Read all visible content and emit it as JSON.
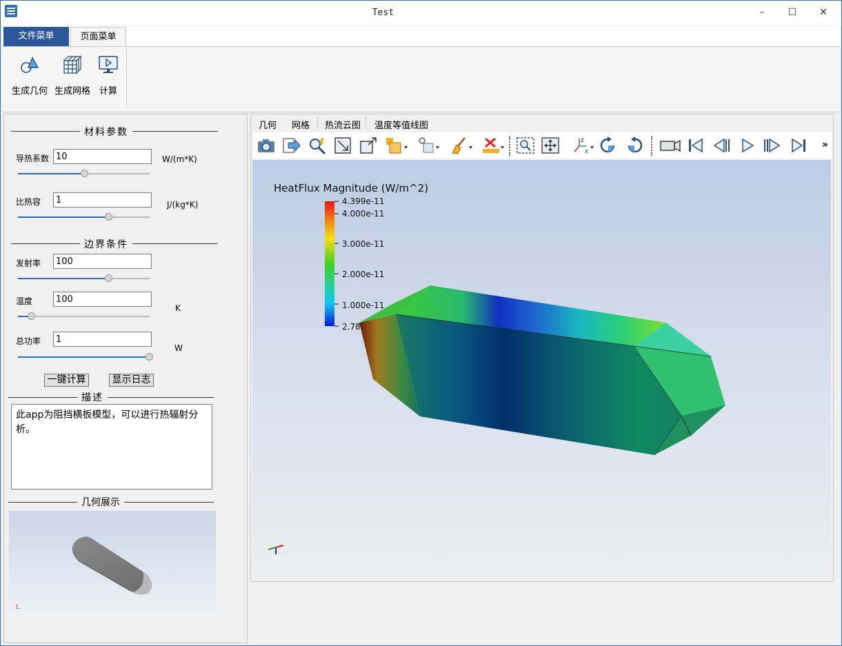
{
  "window": {
    "title": "Test",
    "minimize": "–",
    "maximize": "☐",
    "close": "✕"
  },
  "ribbon_tabs": [
    "文件菜单",
    "页面菜单"
  ],
  "ribbon_buttons": [
    {
      "label": "生成几何",
      "icon": "geometry-icon"
    },
    {
      "label": "生成网格",
      "icon": "mesh-icon"
    },
    {
      "label": "计算",
      "icon": "compute-icon"
    }
  ],
  "material": {
    "title": "材料参数",
    "conductivity": {
      "label": "导热系数",
      "value": "10",
      "unit": "W/(m*K)",
      "level": 0.5
    },
    "heat_capacity": {
      "label": "比热容",
      "value": "1",
      "unit": "J/(kg*K)",
      "level": 0.68
    }
  },
  "boundary": {
    "title": "边界条件",
    "emissivity": {
      "label": "发射率",
      "value": "100",
      "unit": "",
      "level": 0.68
    },
    "temperature": {
      "label": "温度",
      "value": "100",
      "unit": "K",
      "level": 0.1
    },
    "power": {
      "label": "总功率",
      "value": "1",
      "unit": "W",
      "level": 0.99
    }
  },
  "actions": {
    "compute_label": "一键计算",
    "log_label": "显示日志"
  },
  "description": {
    "title": "描述",
    "text": "此app为阻挡横板模型，可以进行热辐射分析。"
  },
  "geometry_view": {
    "title": "几何展示"
  },
  "view_tabs": [
    "几何",
    "网格",
    "热流云图",
    "温度等值线图"
  ],
  "toolbar_icons": [
    "camera-icon",
    "export-icon",
    "query-icon",
    "fit-icon",
    "reset-view-icon",
    "display-mode-icon",
    "light-icon",
    "clean-icon",
    "delete-icon",
    "zoom-box-icon",
    "pan-icon",
    "axes-icon",
    "rotate-cw-icon",
    "rotate-ccw-icon",
    "video-icon",
    "first-frame-icon",
    "prev-frame-icon",
    "play-icon",
    "next-frame-icon",
    "last-frame-icon"
  ],
  "toolbar_more": "»",
  "colorbar": {
    "title": "HeatFlux Magnitude (W/m^2)",
    "max_label": "4.399e-11",
    "min_label": "2.784e-12",
    "ticks": [
      "4.000e-11",
      "3.000e-11",
      "2.000e-11",
      "1.000e-11"
    ]
  }
}
